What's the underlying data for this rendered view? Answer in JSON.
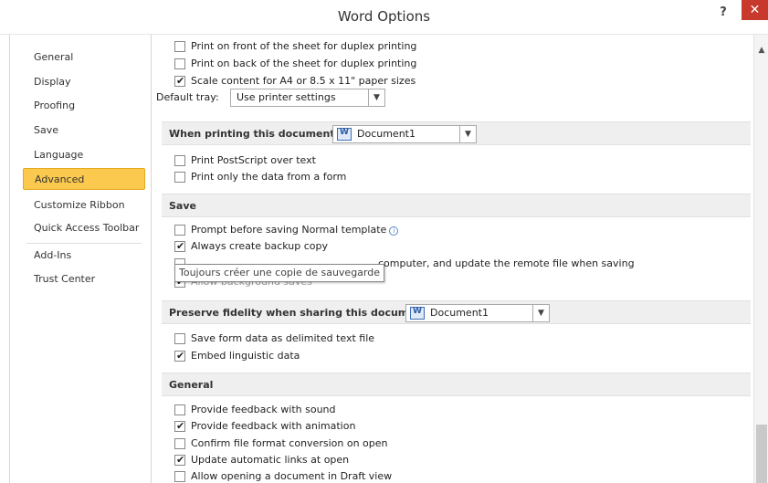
{
  "window": {
    "title": "Word Options",
    "help": "?",
    "close": "✕"
  },
  "sidebar": {
    "items": [
      {
        "label": "General"
      },
      {
        "label": "Display"
      },
      {
        "label": "Proofing"
      },
      {
        "label": "Save"
      },
      {
        "label": "Language"
      },
      {
        "label": "Advanced"
      },
      {
        "label": "Customize Ribbon"
      },
      {
        "label": "Quick Access Toolbar"
      },
      {
        "label": "Add-Ins"
      },
      {
        "label": "Trust Center"
      }
    ],
    "selected": "Advanced"
  },
  "print": {
    "front": {
      "label": "Print on front of the sheet for duplex printing",
      "checked": false
    },
    "back": {
      "label": "Print on back of the sheet for duplex printing",
      "checked": false
    },
    "scale": {
      "label": "Scale content for A4 or 8.5 x 11\" paper sizes",
      "checked": true
    },
    "tray_label": "Default tray:",
    "tray_value": "Use printer settings"
  },
  "when_printing": {
    "title": "When printing this document:",
    "document": "Document1",
    "postscript": {
      "label": "Print PostScript over text",
      "checked": false
    },
    "form_data": {
      "label": "Print only the data from a form",
      "checked": false
    }
  },
  "save": {
    "title": "Save",
    "prompt_normal": {
      "label": "Prompt before saving Normal template",
      "checked": false
    },
    "backup_copy": {
      "label": "Always create backup copy",
      "checked": true
    },
    "copy_remote": {
      "label": "computer, and update the remote file when saving",
      "checked": false
    },
    "background_saves": {
      "label": "Allow background saves",
      "checked": true
    },
    "tooltip": "Toujours créer une copie de sauvegarde"
  },
  "fidelity": {
    "title": "Preserve fidelity when sharing this document:",
    "document": "Document1",
    "form_delimited": {
      "label": "Save form data as delimited text file",
      "checked": false
    },
    "linguistic": {
      "label": "Embed linguistic data",
      "checked": true
    }
  },
  "general": {
    "title": "General",
    "feedback_sound": {
      "label": "Provide feedback with sound",
      "checked": false
    },
    "feedback_animation": {
      "label": "Provide feedback with animation",
      "checked": true
    },
    "confirm_format": {
      "label": "Confirm file format conversion on open",
      "checked": false
    },
    "update_links": {
      "label": "Update automatic links at open",
      "checked": true
    },
    "draft_view": {
      "label": "Allow opening a document in Draft view",
      "checked": false
    }
  },
  "colors": {
    "accent": "#fbc94d",
    "close": "#c7392c",
    "section_bg": "#efefef"
  }
}
